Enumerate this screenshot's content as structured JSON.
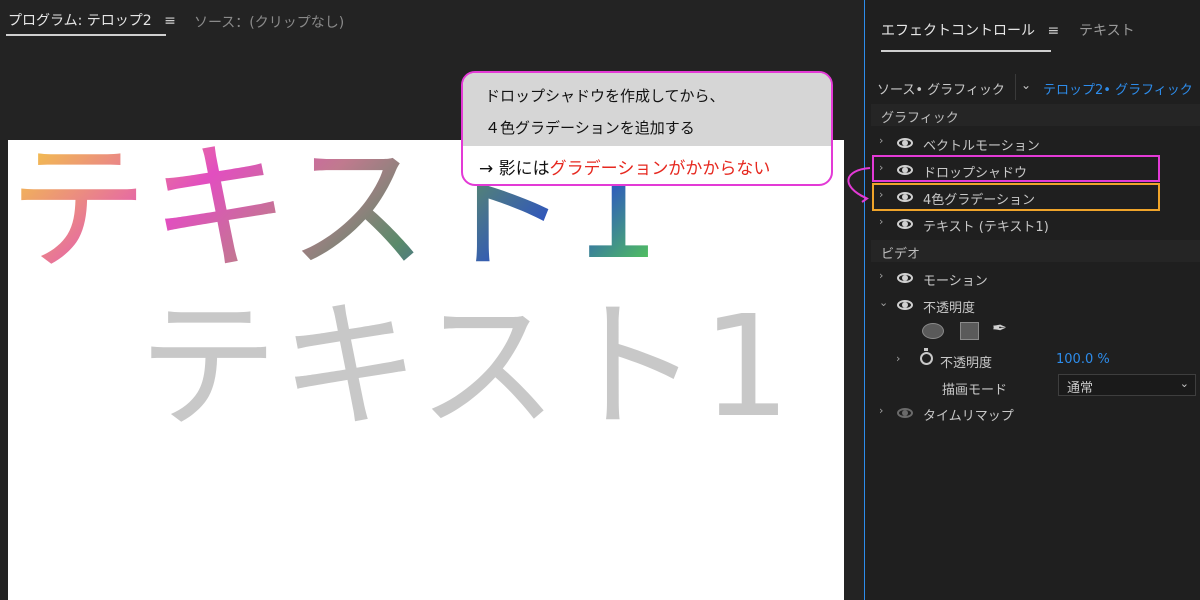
{
  "program_monitor": {
    "tab_title": "プログラム: テロップ2",
    "menu_glyph": "≡",
    "source_tab": "ソース：(クリップなし)",
    "preview_text": "テキスト1"
  },
  "effect_controls": {
    "tab_title": "エフェクトコントロール",
    "menu_glyph": "≡",
    "text_tab": "テキスト",
    "source_label": "ソース• グラフィック",
    "clip_label": "テロップ2• グラフィック",
    "graphic_section": "グラフィック",
    "graphic_items": [
      {
        "label": "ベクトルモーション"
      },
      {
        "label": "ドロップシャドウ"
      },
      {
        "label": "4色グラデーション"
      },
      {
        "label": "テキスト (テキスト1)"
      }
    ],
    "video_section": "ビデオ",
    "video_items": [
      {
        "label": "モーション"
      },
      {
        "label": "不透明度"
      },
      {
        "label": "タイムリマップ"
      }
    ],
    "opacity_param_label": "不透明度",
    "opacity_value": "100.0 %",
    "blend_mode_label": "描画モード",
    "blend_mode_value": "通常"
  },
  "annotation": {
    "line1": "ドロップシャドウを作成してから、",
    "line2": "４色グラデーションを追加する",
    "line3_prefix": "→ 影には",
    "line3_highlight": "グラデーションがかからない"
  },
  "colors": {
    "accent_blue": "#2d8ceb",
    "highlight_magenta": "#e33ad6",
    "highlight_orange": "#f0a42a",
    "annotation_red": "#e6281f"
  }
}
